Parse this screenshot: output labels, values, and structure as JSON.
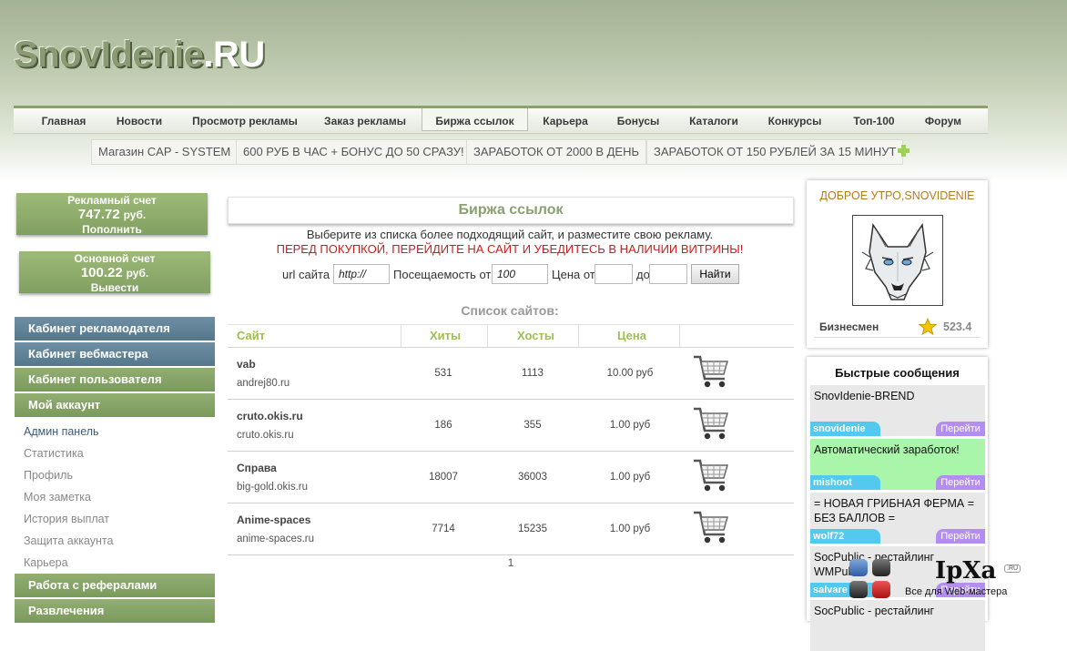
{
  "site": {
    "logo_main": "SnovIdenie",
    "logo_tld": ".RU"
  },
  "topnav": [
    {
      "label": "Главная",
      "active": false
    },
    {
      "label": "Новости",
      "active": false
    },
    {
      "label": "Просмотр рекламы",
      "active": false
    },
    {
      "label": "Заказ рекламы",
      "active": false
    },
    {
      "label": "Биржа ссылок",
      "active": true
    },
    {
      "label": "Карьера",
      "active": false
    },
    {
      "label": "Бонусы",
      "active": false
    },
    {
      "label": "Каталоги",
      "active": false
    },
    {
      "label": "Конкурсы",
      "active": false
    },
    {
      "label": "Топ-100",
      "active": false
    },
    {
      "label": "Форум",
      "active": false
    }
  ],
  "ad_links": [
    "Магазин CAP - SYSTEM",
    "600 РУБ В ЧАС + БОНУС ДО 50 СРАЗУ!",
    "ЗАРАБОТОК ОТ 2000 В ДЕНЬ",
    "ЗАРАБОТОК ОТ 150 РУБЛЕЙ ЗА 15 МИНУТ"
  ],
  "accounts": {
    "ad": {
      "title": "Рекламный счет",
      "amount": "747.72",
      "currency": "руб.",
      "action": "Пополнить"
    },
    "main": {
      "title": "Основной счет",
      "amount": "100.22",
      "currency": "руб.",
      "action": "Вывести"
    }
  },
  "sidebar": {
    "sections_top": [
      "Кабинет рекламодателя",
      "Кабинет вебмастера",
      "Кабинет пользователя",
      "Мой аккаунт"
    ],
    "sub_items": [
      "Админ панель",
      "Статистика",
      "Профиль",
      "Моя заметка",
      "История выплат",
      "Защита аккаунта",
      "Карьера"
    ],
    "sections_bottom": [
      "Работа с рефералами",
      "Развлечения"
    ]
  },
  "exchange": {
    "title": "Биржа ссылок",
    "intro": "Выберите из списка более подходящий сайт, и разместите свою рекламу.",
    "warning": "ПЕРЕД ПОКУПКОЙ, ПЕРЕЙДИТЕ НА САЙТ И УБЕДИТЕСЬ В НАЛИЧИИ ВИТРИНЫ!",
    "search": {
      "url_label": "url сайта",
      "url_value": "http://",
      "visits_label": "Посещаемость от",
      "visits_value": "100",
      "price_label": "Цена от",
      "price_from": "",
      "to_label": "до",
      "price_to": "",
      "button": "Найти"
    },
    "list_title": "Список сайтов:",
    "columns": [
      "Сайт",
      "Хиты",
      "Хосты",
      "Цена"
    ],
    "rows": [
      {
        "name": "vab",
        "host": "andrej80.ru",
        "hits": "531",
        "hosts": "1113",
        "price": "10.00 руб"
      },
      {
        "name": "cruto.okis.ru",
        "host": "cruto.okis.ru",
        "hits": "186",
        "hosts": "355",
        "price": "1.00 руб"
      },
      {
        "name": "Справа",
        "host": "big-gold.okis.ru",
        "hits": "18007",
        "hosts": "36003",
        "price": "1.00 руб"
      },
      {
        "name": "Anime-spaces",
        "host": "anime-spaces.ru",
        "hits": "7714",
        "hosts": "15235",
        "price": "1.00 руб"
      }
    ],
    "page": "1"
  },
  "user": {
    "greeting": "ДОБРОЕ УТРО,SNOVIDENIE",
    "status": "Бизнесмен",
    "rating": "523.4"
  },
  "quick_messages": {
    "title": "Быстрые сообщения",
    "go_label": "Перейти",
    "items": [
      {
        "text": "SnovIdenie-BREND",
        "author": "snovidenie",
        "bg": "#e8e8e8"
      },
      {
        "text": "Автоматический заработок!",
        "author": "mishoot",
        "bg": "#a9f5a9"
      },
      {
        "text": "= НОВАЯ ГРИБНАЯ ФЕРМА = БЕЗ БАЛЛОВ =",
        "author": "wolf72",
        "bg": "#e8e8e8"
      },
      {
        "text": "SocPublic - рестайлинг WMPublic",
        "author": "salvare",
        "bg": "#e8e8e8"
      },
      {
        "text": "SocPublic - рестайлинг",
        "author": "",
        "bg": "#e8e8e8"
      }
    ]
  },
  "watermark": {
    "brand": "IpXa",
    "badge": ".RU",
    "tagline": "Все для Web-мастера"
  }
}
